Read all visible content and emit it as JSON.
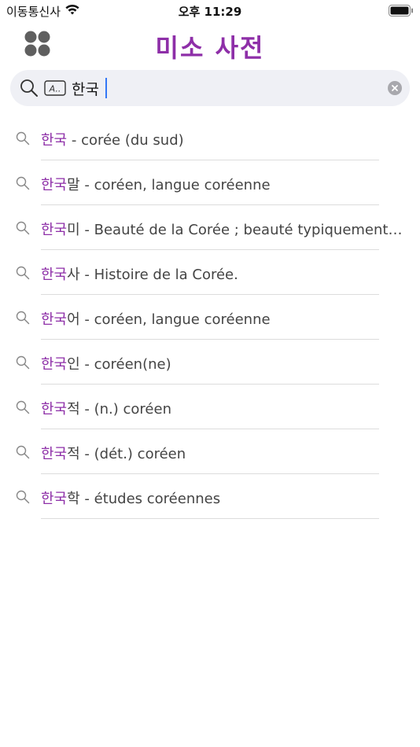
{
  "status_bar": {
    "carrier": "이동통신사",
    "time": "오후 11:29"
  },
  "header": {
    "title": "미소 사전"
  },
  "search": {
    "value": "한국",
    "handwriting_label": "A.."
  },
  "colors": {
    "accent": "#8e2fa8",
    "caret": "#3478f6",
    "search_bg": "#eff0f5"
  },
  "results": [
    {
      "match": "한국",
      "rest": " - corée (du sud)"
    },
    {
      "match": "한국",
      "rest": "말 - coréen, langue coréenne"
    },
    {
      "match": "한국",
      "rest": "미 - Beauté de la Corée ; beauté typiquement coréenne"
    },
    {
      "match": "한국",
      "rest": "사 - Histoire de la Corée."
    },
    {
      "match": "한국",
      "rest": "어 - coréen, langue coréenne"
    },
    {
      "match": "한국",
      "rest": "인 - coréen(ne)"
    },
    {
      "match": "한국",
      "rest": "적 - (n.) coréen"
    },
    {
      "match": "한국",
      "rest": "적 - (dét.) coréen"
    },
    {
      "match": "한국",
      "rest": "학 - études coréennes"
    }
  ]
}
